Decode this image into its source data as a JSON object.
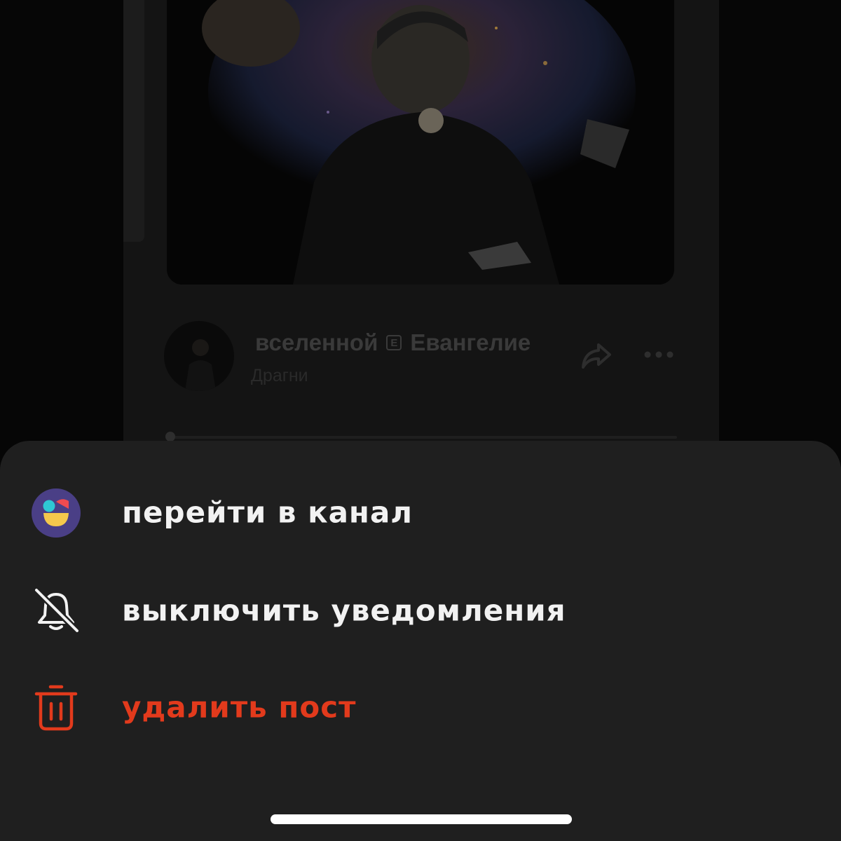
{
  "colors": {
    "sheet_background": "#1f1f1f",
    "menu_text": "#f2f2f2",
    "danger_text": "#e23a1c",
    "background_text": "#3a3a3a"
  },
  "background_post": {
    "cover_art_icon": "cosmic-portrait-artwork",
    "track": {
      "title_part1": "вселенной",
      "explicit_badge": "E",
      "title_part2": "Евангелие",
      "artist": "Драгни",
      "share_icon": "share-icon",
      "more_icon": "more-dots-icon"
    }
  },
  "action_sheet": {
    "items": [
      {
        "label": "перейти в канал",
        "icon": "channel-logo-icon"
      },
      {
        "label": "выключить уведомления",
        "icon": "bell-off-icon"
      },
      {
        "label": "удалить пост",
        "icon": "trash-icon"
      }
    ]
  }
}
